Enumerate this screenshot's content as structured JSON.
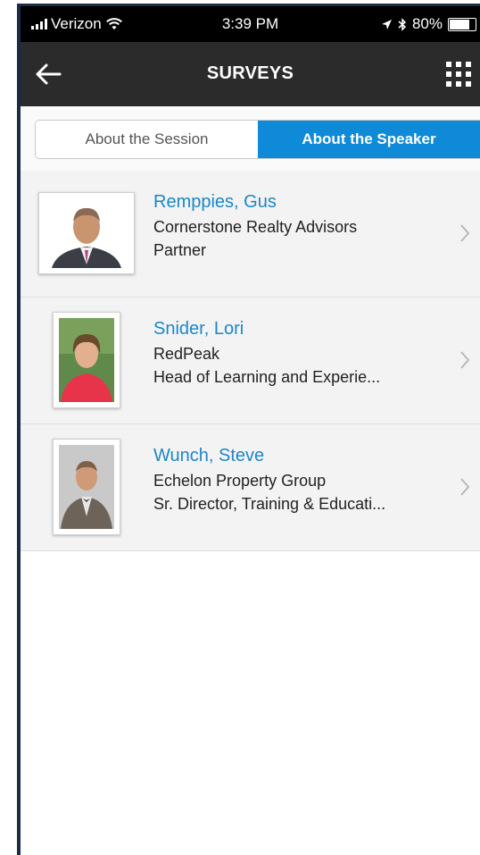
{
  "status_bar": {
    "carrier": "Verizon",
    "time": "3:39 PM",
    "battery": "80%",
    "battery_level": 0.8
  },
  "nav": {
    "title": "SURVEYS",
    "back_icon": "arrow-left-icon",
    "menu_icon": "grid-menu-icon"
  },
  "tabs": [
    {
      "label": "About the Session",
      "active": false
    },
    {
      "label": "About the Speaker",
      "active": true
    }
  ],
  "speakers": [
    {
      "name": "Remppies, Gus",
      "company": "Cornerstone Realty Advisors",
      "title": "Partner"
    },
    {
      "name": "Snider, Lori",
      "company": "RedPeak",
      "title": "Head of Learning and Experie..."
    },
    {
      "name": "Wunch, Steve",
      "company": "Echelon Property Group",
      "title": "Sr. Director, Training & Educati..."
    }
  ],
  "colors": {
    "accent": "#0e8ad8",
    "name_link": "#1d86c6",
    "navbar": "#2b2b2b"
  }
}
